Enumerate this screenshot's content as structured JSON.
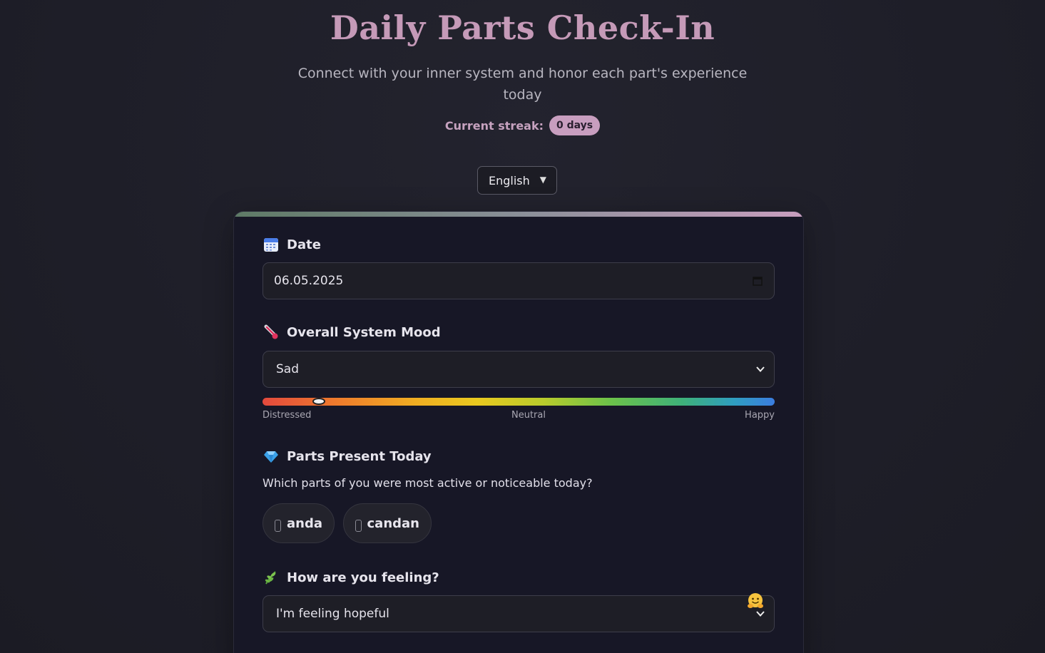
{
  "header": {
    "title": "Daily Parts Check-In",
    "subtitle": "Connect with your inner system and honor each part's experience today",
    "streak_label": "Current streak:",
    "streak_value": "0 days"
  },
  "language": {
    "selected": "English"
  },
  "form": {
    "date": {
      "label": "Date",
      "value": "06.05.2025",
      "icon": "calendar-icon"
    },
    "mood": {
      "label": "Overall System Mood",
      "icon": "thermometer-icon",
      "selected": "Sad",
      "slider_fraction": 0.11,
      "scale": {
        "low": "Distressed",
        "mid": "Neutral",
        "high": "Happy"
      }
    },
    "parts": {
      "label": "Parts Present Today",
      "icon": "gem-icon",
      "question": "Which parts of you were most active or noticeable today?",
      "items": [
        {
          "name": "anda",
          "checked": false
        },
        {
          "name": "candan",
          "checked": false
        }
      ]
    },
    "feeling": {
      "label": "How are you feeling?",
      "icon": "herb-icon",
      "selected": "I'm feeling hopeful",
      "emoji": "hugging-face-icon"
    }
  },
  "colors": {
    "title": "#c59ab8",
    "accent": "#c89ebf",
    "card_bg": "#171726",
    "page_bg": "#1f1f2a"
  }
}
